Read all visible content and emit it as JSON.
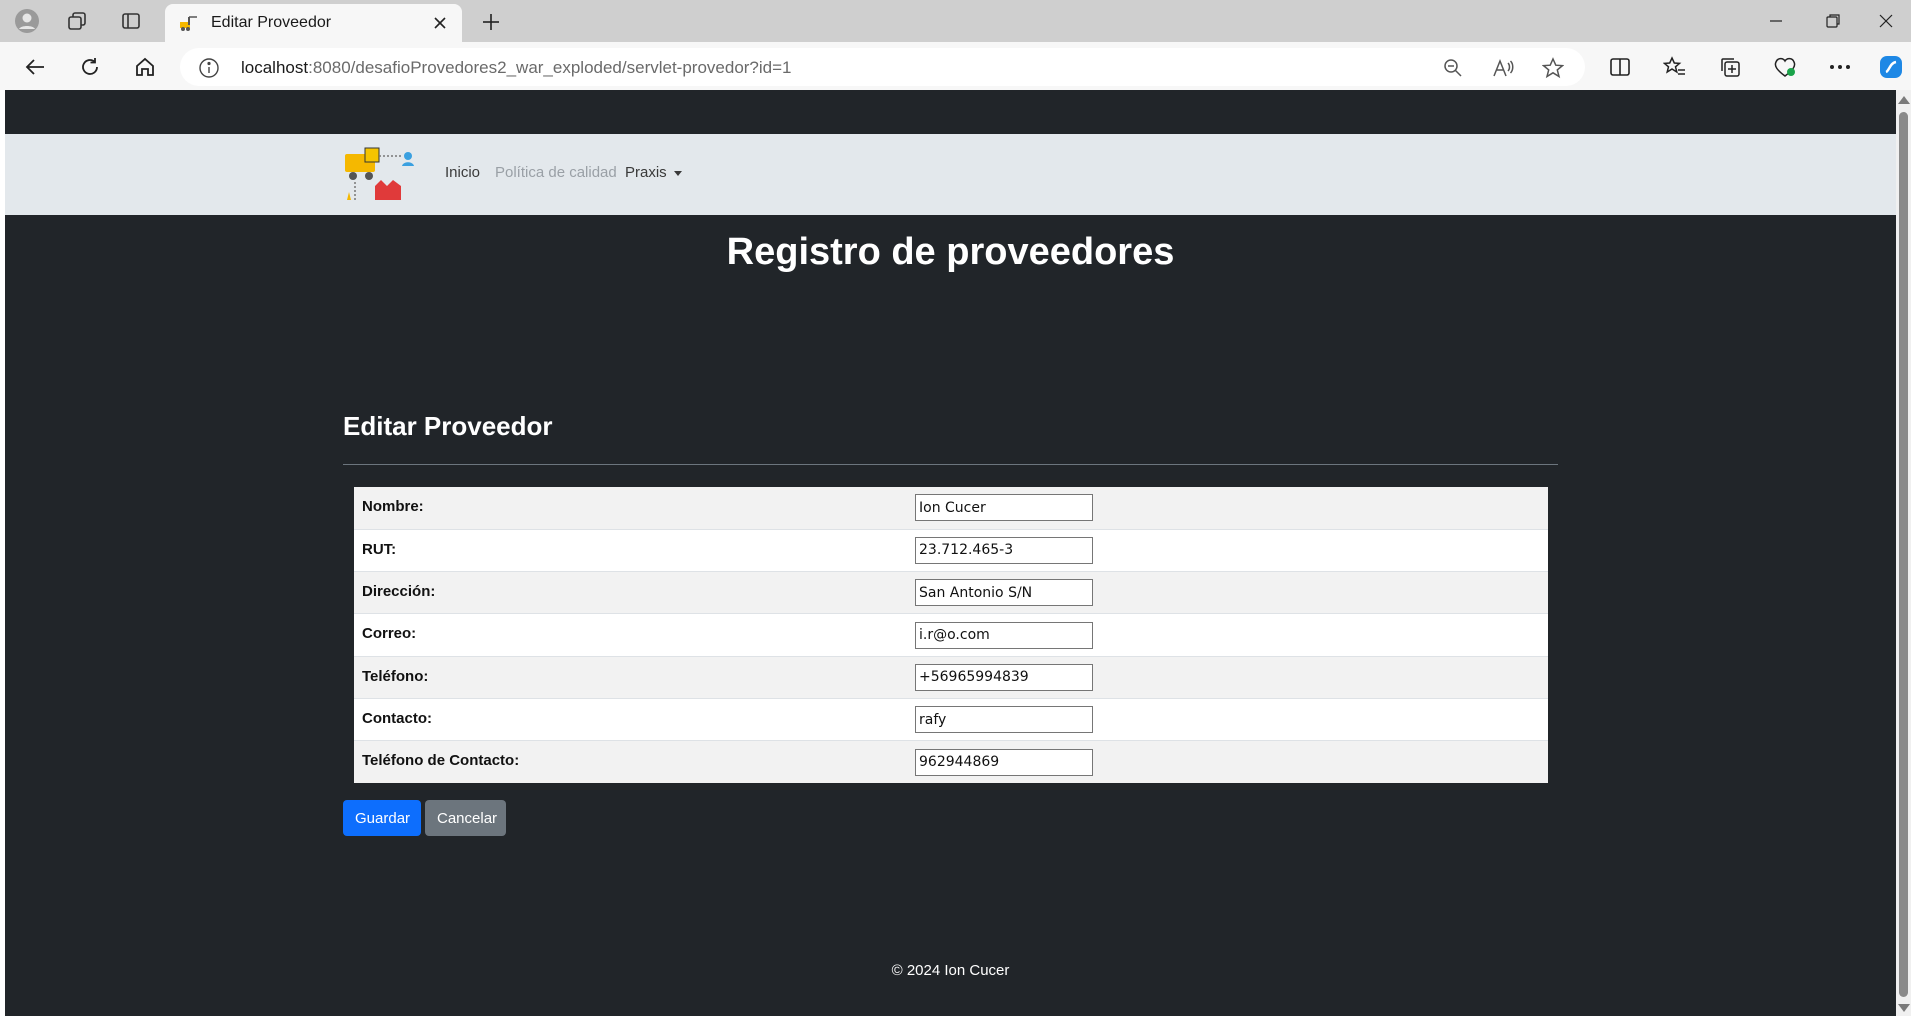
{
  "browser": {
    "tab_title": "Editar Proveedor",
    "url_host": "localhost",
    "url_rest": ":8080/desafioProvedores2_war_exploded/servlet-provedor?id=1",
    "icons": [
      "profile-icon",
      "workspaces-icon",
      "tab-actions-icon",
      "favicon",
      "close-icon",
      "new-tab-icon",
      "minimize-icon",
      "restore-icon",
      "window-close-icon",
      "back-icon",
      "refresh-icon",
      "home-icon",
      "info-icon",
      "zoom-out-icon",
      "read-aloud-icon",
      "favorite-star-icon",
      "split-screen-icon",
      "favorites-icon",
      "collections-icon",
      "performance-icon",
      "more-icon",
      "copilot-icon"
    ]
  },
  "nav": {
    "items": [
      {
        "label": "Inicio"
      },
      {
        "label": "Política de calidad"
      },
      {
        "label": "Praxis"
      }
    ]
  },
  "page": {
    "title": "Registro de proveedores",
    "section_title": "Editar Proveedor"
  },
  "form": {
    "fields": [
      {
        "label": "Nombre:",
        "value": "Ion Cucer"
      },
      {
        "label": "RUT:",
        "value": "23.712.465-3"
      },
      {
        "label": "Dirección:",
        "value": "San Antonio S/N"
      },
      {
        "label": "Correo:",
        "value": "i.r@o.com"
      },
      {
        "label": "Teléfono:",
        "value": "+56965994839"
      },
      {
        "label": "Contacto:",
        "value": "rafy"
      },
      {
        "label": "Teléfono de Contacto:",
        "value": "962944869"
      }
    ],
    "save_label": "Guardar",
    "cancel_label": "Cancelar"
  },
  "footer": {
    "text": "© 2024 Ion Cucer"
  },
  "colors": {
    "page_bg": "#212529",
    "nav_bg": "#e3e8ec",
    "primary": "#0d6efd",
    "secondary": "#6c757d"
  }
}
